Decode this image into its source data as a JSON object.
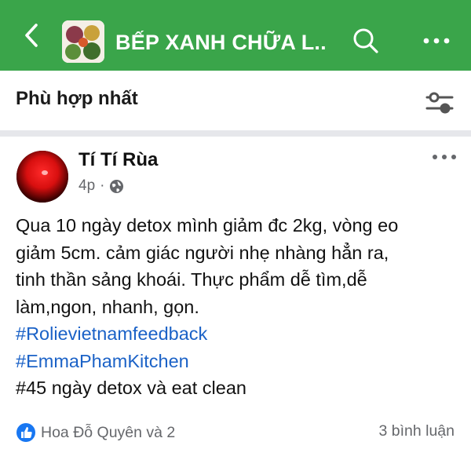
{
  "colors": {
    "brand": "#3aa54a",
    "link": "#1b62c7",
    "muted": "#65676b"
  },
  "header": {
    "title": "BẾP XANH CHỮA L...",
    "back_icon": "back-arrow-icon",
    "search_icon": "search-icon",
    "more_icon": "more-horizontal-icon"
  },
  "sort": {
    "label": "Phù hợp nhất",
    "icon": "filter-sliders-icon"
  },
  "post": {
    "author": "Tí Tí Rùa",
    "time": "4p",
    "privacy_icon": "globe-icon",
    "lines": [
      "Qua 10 ngày detox mình giảm đc 2kg, vòng eo",
      "giảm 5cm.  cảm giác người nhẹ nhàng hẳn ra,",
      "tinh thần sảng khoái. Thực phẩm dễ tìm,dễ",
      "làm,ngon, nhanh, gọn."
    ],
    "hashtags": [
      "#Rolievietnamfeedback",
      "#EmmaPhamKitchen"
    ],
    "last_line": "#45 ngày detox và eat clean",
    "reactions_text": "Hoa Đỗ Quyên và 2",
    "comments_text": "3 bình luận"
  }
}
